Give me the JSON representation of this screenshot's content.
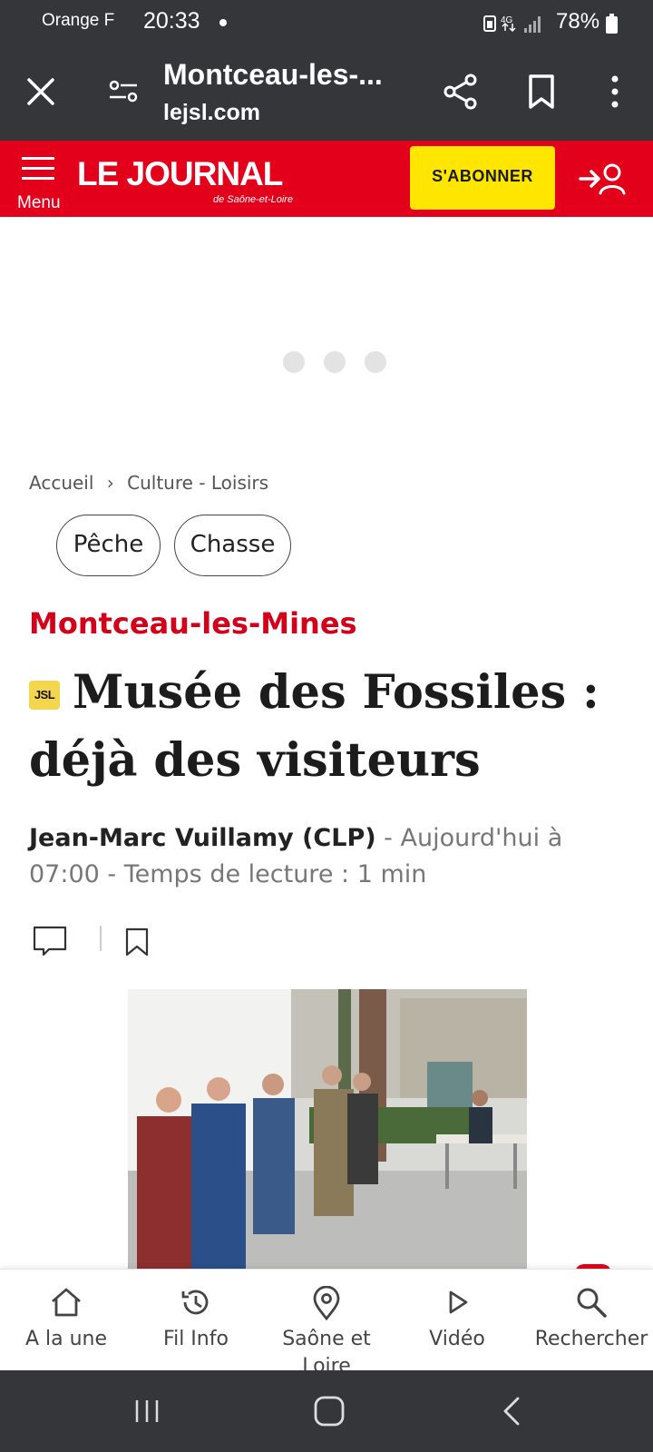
{
  "status_bar": {
    "carrier": "Orange F",
    "time": "20:33",
    "battery": "78%"
  },
  "browser": {
    "title": "Montceau-les-...",
    "url": "lejsl.com",
    "icons": [
      "close-icon",
      "site-settings-icon",
      "share-icon",
      "bookmark-icon",
      "more-vert-icon"
    ]
  },
  "site_header": {
    "menu_label": "Menu",
    "logo_main": "LE JOURNAL",
    "logo_sub": "de Saône-et-Loire",
    "subscribe_label": "S'ABONNER",
    "brand_color": "#e2001a",
    "subscribe_color": "#ffe600"
  },
  "breadcrumb": {
    "home": "Accueil",
    "section": "Culture - Loisirs"
  },
  "tags": [
    "Pêche",
    "Chasse"
  ],
  "article": {
    "section_label": "Montceau-les-Mines",
    "badge": "JSL",
    "headline": "Musée des Fossiles : déjà des visiteurs",
    "author": "Jean-Marc Vuillamy (CLP)",
    "meta": " - Aujourd'hui à 07:00 - Temps de lecture : 1 min"
  },
  "bottom_nav": [
    {
      "label": "A la une",
      "icon": "home-icon"
    },
    {
      "label": "Fil Info",
      "icon": "history-icon"
    },
    {
      "label": "Saône et Loire",
      "icon": "location-pin-icon"
    },
    {
      "label": "Vidéo",
      "icon": "play-icon"
    },
    {
      "label": "Rechercher",
      "icon": "search-icon"
    }
  ]
}
